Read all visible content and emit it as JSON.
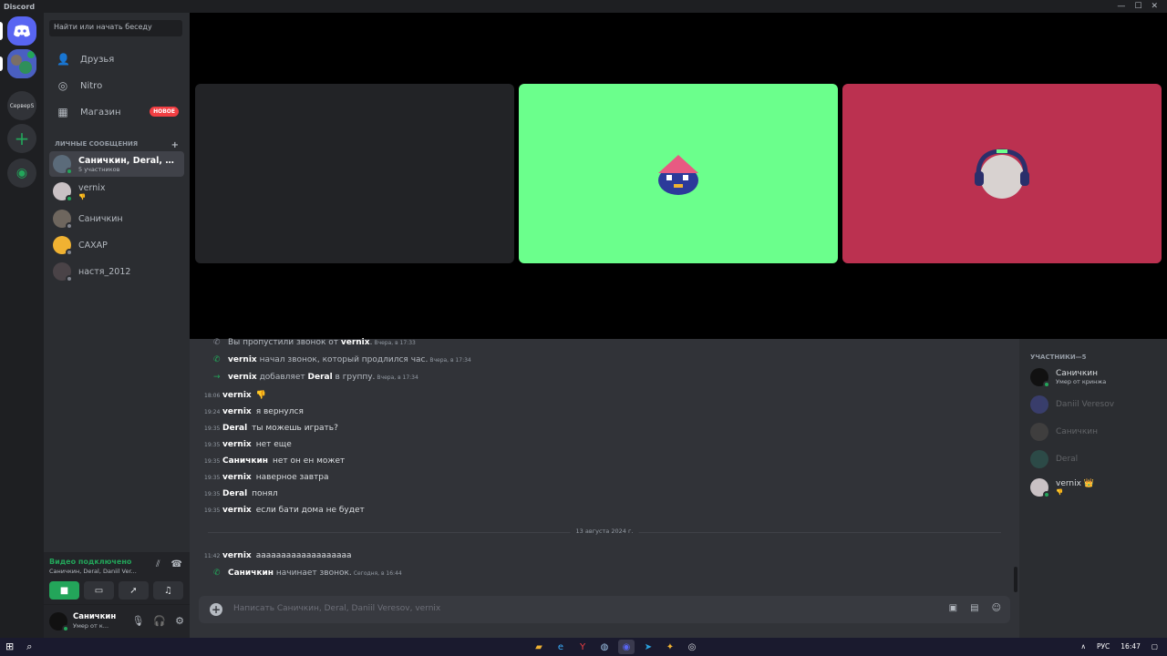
{
  "app_title": "Discord",
  "window_controls": {
    "minimize": "—",
    "maximize": "☐",
    "close": "✕"
  },
  "servers": [
    {
      "label": "СерверS"
    }
  ],
  "search_placeholder": "Найти или начать беседу",
  "nav": {
    "friends": "Друзья",
    "nitro": "Nitro",
    "shop": "Магазин",
    "shop_badge": "НОВОЕ"
  },
  "dm_section": {
    "title": "ЛИЧНЫЕ СООБЩЕНИЯ",
    "add": "+"
  },
  "dms": [
    {
      "name": "Саничкин, Deral, Dan...",
      "sub": "5 участников"
    },
    {
      "name": "vernix",
      "sub": "👎"
    },
    {
      "name": "Саничкин",
      "sub": ""
    },
    {
      "name": "САХАР",
      "sub": ""
    },
    {
      "name": "настя_2012",
      "sub": ""
    }
  ],
  "voice": {
    "status": "Видео подключено",
    "channel": "Саничкин, Deral, Daniil Ver..."
  },
  "user": {
    "name": "Саничкин",
    "status": "Умер от к..."
  },
  "chat": {
    "system": [
      {
        "pre": "Вы пропустили звонок от ",
        "author": "vernix",
        "post": ".",
        "meta": "Вчера, в 17:33"
      },
      {
        "author": "vernix",
        "post": " начал звонок, который продлился час.",
        "meta": "Вчера, в 17:34"
      },
      {
        "author": "vernix",
        "post": " добавляет ",
        "target": "Deral",
        "post2": " в группу.",
        "meta": "Вчера, в 17:34"
      }
    ],
    "messages": [
      {
        "time": "18:06",
        "author": "vernix",
        "text": "👎"
      },
      {
        "time": "19:24",
        "author": "vernix",
        "text": "я вернулся"
      },
      {
        "time": "19:35",
        "author": "Deral",
        "text": "ты можешь играть?"
      },
      {
        "time": "19:35",
        "author": "vernix",
        "text": "нет еще"
      },
      {
        "time": "19:35",
        "author": "Саничкин",
        "text": "нет он ен может"
      },
      {
        "time": "19:35",
        "author": "vernix",
        "text": "наверное завтра"
      },
      {
        "time": "19:35",
        "author": "Deral",
        "text": "понял"
      },
      {
        "time": "19:35",
        "author": "vernix",
        "text": "если бати дома не будет"
      }
    ],
    "date_divider": "13 августа 2024 г.",
    "last_message": {
      "time": "11:42",
      "author": "vernix",
      "text": "ааааааааааааааааааа"
    },
    "last_system": {
      "author": "Саничкин",
      "post": " начинает звонок.",
      "meta": "Сегодня, в 16:44"
    },
    "composer_placeholder": "Написать Саничкин, Deral, Daniil Veresov, vernix"
  },
  "members": {
    "header": "УЧАСТНИКИ—5",
    "list": [
      {
        "name": "Саничкин",
        "status": "Умер от кринжа",
        "online": true
      },
      {
        "name": "Daniil Veresov",
        "status": "",
        "online": false
      },
      {
        "name": "Саничкин",
        "status": "",
        "online": false
      },
      {
        "name": "Deral",
        "status": "",
        "online": false
      },
      {
        "name": "vernix",
        "status": "👎",
        "online": true,
        "crown": "👑"
      }
    ]
  },
  "taskbar": {
    "lang": "РУС",
    "time": "16:47"
  },
  "colors": {
    "accent": "#5865f2",
    "online": "#23a55a",
    "tile_green": "#6bff8c",
    "tile_red": "#bb3150",
    "tile_gray": "#222326"
  }
}
